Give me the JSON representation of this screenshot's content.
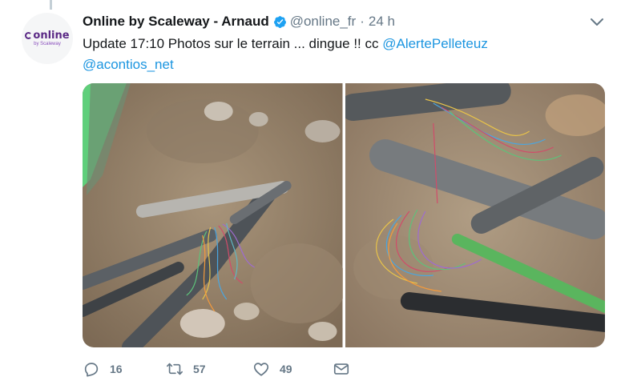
{
  "tweet": {
    "author_name": "Online by Scaleway - Arnaud",
    "handle": "@online_fr",
    "separator": "·",
    "time": "24 h",
    "avatar": {
      "logo_text": "online",
      "logo_subtext": "by Scaleway"
    },
    "text_prefix": "Update 17:10 Photos sur le terrain ... dingue !! cc ",
    "mention_1": "@AlertePelleteuz",
    "mention_2": "@acontios_net",
    "photos": [
      {
        "description": "photo-1"
      },
      {
        "description": "photo-2"
      }
    ]
  },
  "actions": {
    "reply_count": "16",
    "retweet_count": "57",
    "like_count": "49"
  },
  "icons": {
    "verified": "verified-badge-icon",
    "chevron": "chevron-down-icon",
    "reply": "reply-icon",
    "retweet": "retweet-icon",
    "like": "heart-icon",
    "dm": "envelope-icon"
  },
  "colors": {
    "accent": "#1b95e0",
    "muted": "#657786",
    "text": "#14171a",
    "brand": "#5b2a86"
  }
}
